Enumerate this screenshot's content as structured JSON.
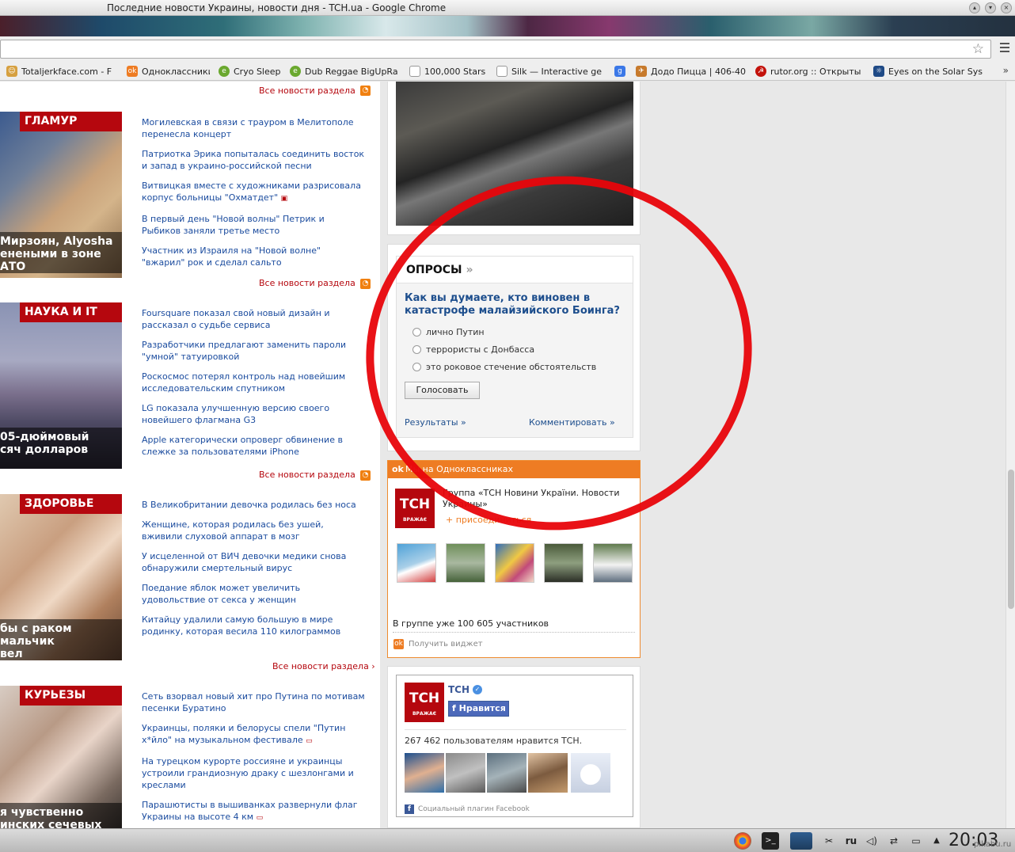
{
  "window": {
    "title": "Последние новости Украины, новости дня - TCH.ua - Google Chrome"
  },
  "bookmarks": [
    {
      "label": "Totaljerkface.com - F",
      "icon": "face-icon",
      "color": "#d6a040"
    },
    {
      "label": "Одноклассники",
      "icon": "odnoklassniki-icon",
      "color": "#ee7c23"
    },
    {
      "label": "Cryo Sleep",
      "icon": "e-icon",
      "color": "#6aa82e"
    },
    {
      "label": "Dub Reggae BigUpRa",
      "icon": "e-icon",
      "color": "#6aa82e"
    },
    {
      "label": "100,000 Stars",
      "icon": "page-icon",
      "color": "#ffffff"
    },
    {
      "label": "Silk — Interactive ge",
      "icon": "page-icon",
      "color": "#ffffff"
    },
    {
      "label": "",
      "icon": "google-icon",
      "color": "#3b78e7"
    },
    {
      "label": "Додо Пицца | 406-40",
      "icon": "dodo-icon",
      "color": "#c77a2c"
    },
    {
      "label": "rutor.org :: Открыты",
      "icon": "rutor-icon",
      "color": "#c3120b"
    },
    {
      "label": "Eyes on the Solar Sys",
      "icon": "nasa-icon",
      "color": "#1f4a86"
    }
  ],
  "main": {
    "all_news_label": "Все новости раздела",
    "all_news_label_arrow": "Все новости раздела ›",
    "sections": [
      {
        "tag": "ГЛАМУР",
        "headline": " Мирзоян, Alyosha\nенеными в зоне АТО",
        "news": [
          "Могилевская в связи с трауром в Мелитополе перенесла концерт",
          "Патриотка Эрика попыталась соединить восток и запад в украино-российской песни",
          "Витвицкая вместе с художниками разрисовала корпус больницы \"Охматдет\"",
          "В первый день \"Новой волны\" Петрик и Рыбиков заняли третье место",
          "Участник из Израиля на \"Новой волне\" \"вжарил\" рок и сделал сальто"
        ]
      },
      {
        "tag": "НАУКА И IT",
        "headline": "05-дюймовый\nсяч долларов",
        "news": [
          "Foursquare показал свой новый дизайн и рассказал о судьбе сервиса",
          "Разработчики предлагают заменить пароли \"умной\" татуировкой",
          "Роскосмос потерял контроль над новейшим исследовательским спутником",
          "LG показала улучшенную версию своего новейшего флагмана G3",
          "Apple категорически опроверг обвинение в слежке за пользователями iPhone"
        ]
      },
      {
        "tag": "ЗДОРОВЬЕ",
        "headline": "бы с раком мальчик\nвел",
        "news": [
          "В Великобритании девочка родилась без носа",
          "Женщине, которая родилась без ушей, вживили слуховой аппарат в мозг",
          "У исцеленной от ВИЧ девочки медики снова обнаружили смертельный вирус",
          "Поедание яблок может увеличить удовольствие от секса у женщин",
          "Китайцу удалили самую большую в мире родинку, которая весила 110 килограммов"
        ]
      },
      {
        "tag": "КУРЬЕЗЫ",
        "headline": "я чувственно\nинских сечевых",
        "news": [
          "Сеть взорвал новый хит про Путина по мотивам песенки Буратино",
          "Украинцы, поляки и белорусы спели \"Путин х*йло\" на музыкальном фестивале",
          "На турецком курорте россияне и украинцы устроили грандиозную драку с шезлонгами и креслами",
          "Парашютисты в вышиванках развернули флаг Украины на высоте 4 км"
        ]
      }
    ]
  },
  "poll": {
    "header": "ОПРОСЫ",
    "question": "Как вы думаете, кто виновен в катастрофе малайзийского Боинга?",
    "options": [
      "лично Путин",
      "террористы с Донбасса",
      "это роковое стечение обстоятельств"
    ],
    "vote_label": "Голосовать",
    "results_label": "Результаты »",
    "comment_label": "Комментировать »"
  },
  "odnoklassniki": {
    "header": "Мы на Одноклассниках",
    "group_name": "Группа «ТСН Новини України. Новости Украины»",
    "join_label": "присоединиться",
    "members_text": "В группе уже 100 605 участников",
    "get_widget_label": "Получить виджет"
  },
  "logo": {
    "text": "ТСН",
    "sub": "ВРАЖАЄ"
  },
  "facebook": {
    "page_name": "ТСН",
    "like_label": "Нравится",
    "likes_text": "267 462 пользователям нравится ТСН.",
    "plugin_label": "Социальный плагин Facebook"
  },
  "taskbar": {
    "lang": "ru",
    "clock": "20:03"
  },
  "watermark": "pikabu.ru",
  "colors": {
    "brand_red": "#b5070e",
    "link_blue": "#1a4b9e",
    "ok_orange": "#ee7c23",
    "annotation_circle": "#e8050b",
    "fb_blue": "#3b5998"
  }
}
